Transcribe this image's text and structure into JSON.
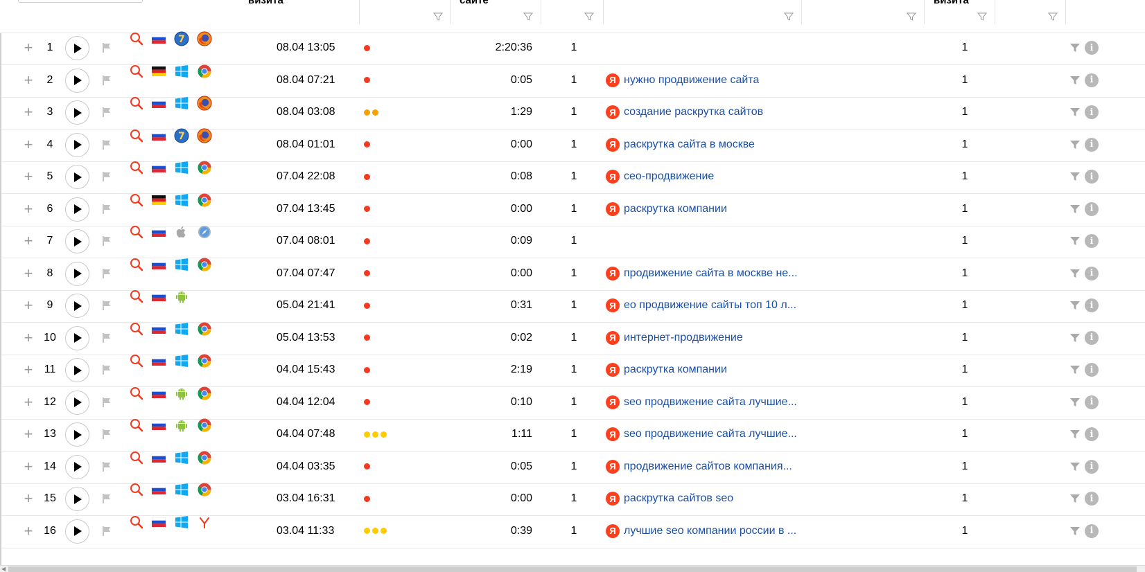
{
  "header": {
    "col_visit_label": "визита",
    "col_site_label": "сайте",
    "col_visit2_label": "визита"
  },
  "colors": {
    "link": "#1a4fa8",
    "yandex": "#fc3f1d",
    "dot_red": "#f33a1f",
    "dot_orange": "#f7a200",
    "dot_yellow": "#ffcc00"
  },
  "rows": [
    {
      "n": "1",
      "country": "ru",
      "os": "win7",
      "browser": "firefox",
      "date": "08.04 13:05",
      "dots": [
        "red"
      ],
      "duration": "2:20:36",
      "pages": "1",
      "source": "",
      "visits": "1"
    },
    {
      "n": "2",
      "country": "de",
      "os": "windows",
      "browser": "chrome",
      "date": "08.04 07:21",
      "dots": [
        "red"
      ],
      "duration": "0:05",
      "pages": "1",
      "source": "нужно продвижение сайта",
      "visits": "1"
    },
    {
      "n": "3",
      "country": "ru",
      "os": "windows",
      "browser": "firefox",
      "date": "08.04 03:08",
      "dots": [
        "orange",
        "orange"
      ],
      "duration": "1:29",
      "pages": "1",
      "source": "создание раскрутка сайтов",
      "visits": "1"
    },
    {
      "n": "4",
      "country": "ru",
      "os": "win7",
      "browser": "firefox",
      "date": "08.04 01:01",
      "dots": [
        "red"
      ],
      "duration": "0:00",
      "pages": "1",
      "source": "раскрутка сайта в москве",
      "visits": "1"
    },
    {
      "n": "5",
      "country": "ru",
      "os": "windows",
      "browser": "chrome",
      "date": "07.04 22:08",
      "dots": [
        "red"
      ],
      "duration": "0:08",
      "pages": "1",
      "source": "сео-продвижение",
      "visits": "1"
    },
    {
      "n": "6",
      "country": "de",
      "os": "windows",
      "browser": "chrome",
      "date": "07.04 13:45",
      "dots": [
        "red"
      ],
      "duration": "0:00",
      "pages": "1",
      "source": "раскрутка компании",
      "visits": "1"
    },
    {
      "n": "7",
      "country": "ru",
      "os": "apple",
      "browser": "safari",
      "date": "07.04 08:01",
      "dots": [
        "red"
      ],
      "duration": "0:09",
      "pages": "1",
      "source": "",
      "visits": "1"
    },
    {
      "n": "8",
      "country": "ru",
      "os": "windows",
      "browser": "chrome",
      "date": "07.04 07:47",
      "dots": [
        "red"
      ],
      "duration": "0:00",
      "pages": "1",
      "source": "продвижение сайта в москве не...",
      "visits": "1"
    },
    {
      "n": "9",
      "country": "ru",
      "os": "android",
      "browser": "",
      "date": "05.04 21:41",
      "dots": [
        "red"
      ],
      "duration": "0:31",
      "pages": "1",
      "source": "ео продвижение сайты топ 10 л...",
      "visits": "1"
    },
    {
      "n": "10",
      "country": "ru",
      "os": "windows",
      "browser": "chrome",
      "date": "05.04 13:53",
      "dots": [
        "red"
      ],
      "duration": "0:02",
      "pages": "1",
      "source": "интернет-продвижение",
      "visits": "1"
    },
    {
      "n": "11",
      "country": "ru",
      "os": "windows",
      "browser": "chrome",
      "date": "04.04 15:43",
      "dots": [
        "red"
      ],
      "duration": "2:19",
      "pages": "1",
      "source": "раскрутка компании",
      "visits": "1"
    },
    {
      "n": "12",
      "country": "ru",
      "os": "android",
      "browser": "chrome",
      "date": "04.04 12:04",
      "dots": [
        "red"
      ],
      "duration": "0:10",
      "pages": "1",
      "source": "seo продвижение сайта лучшие...",
      "visits": "1"
    },
    {
      "n": "13",
      "country": "ru",
      "os": "android",
      "browser": "chrome",
      "date": "04.04 07:48",
      "dots": [
        "yellow",
        "yellow",
        "yellow"
      ],
      "duration": "1:11",
      "pages": "1",
      "source": "seo продвижение сайта лучшие...",
      "visits": "1"
    },
    {
      "n": "14",
      "country": "ru",
      "os": "windows",
      "browser": "chrome",
      "date": "04.04 03:35",
      "dots": [
        "red"
      ],
      "duration": "0:05",
      "pages": "1",
      "source": "продвижение сайтов компания...",
      "visits": "1"
    },
    {
      "n": "15",
      "country": "ru",
      "os": "windows",
      "browser": "chrome",
      "date": "03.04 16:31",
      "dots": [
        "red"
      ],
      "duration": "0:00",
      "pages": "1",
      "source": "раскрутка сайтов seo",
      "visits": "1"
    },
    {
      "n": "16",
      "country": "ru",
      "os": "windows",
      "browser": "yandex",
      "date": "03.04 11:33",
      "dots": [
        "yellow",
        "yellow",
        "yellow"
      ],
      "duration": "0:39",
      "pages": "1",
      "source": "лучшие seo компании россии в ...",
      "visits": "1"
    }
  ]
}
